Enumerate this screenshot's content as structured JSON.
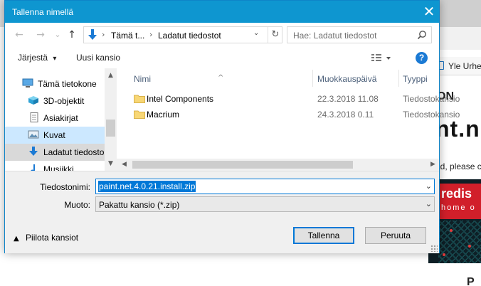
{
  "background": {
    "bookmark_label": "Yle Urheil",
    "heading_fragment": "ON",
    "big_text": "nt.n",
    "small_text": "ad, please c",
    "ad_brand": "redis",
    "ad_tagline": "home o",
    "bottom_letter": "P"
  },
  "dialog": {
    "title": "Tallenna nimellä",
    "close_glyph": "✕"
  },
  "nav": {
    "back_glyph": "←",
    "forward_glyph": "→",
    "recent_glyph": "⌄",
    "up_glyph": "↑",
    "address": {
      "crumbs": [
        "Tämä t...",
        "Ladatut tiedostot"
      ],
      "separator": "›",
      "dropdown_glyph": "⌄",
      "refresh_glyph": "↻"
    },
    "search_placeholder": "Hae: Ladatut tiedostot"
  },
  "toolbar": {
    "organize_label": "Järjestä",
    "organize_caret": "▾",
    "new_folder_label": "Uusi kansio",
    "view_caret": "▾",
    "help_label": "?"
  },
  "tree": [
    {
      "label": "Tämä tietokone",
      "icon": "monitor-icon"
    },
    {
      "label": "3D-objektit",
      "icon": "cube-icon"
    },
    {
      "label": "Asiakirjat",
      "icon": "document-icon"
    },
    {
      "label": "Kuvat",
      "icon": "pictures-icon"
    },
    {
      "label": "Ladatut tiedosto",
      "icon": "download-icon"
    },
    {
      "label": "Musiikki",
      "icon": "music-icon"
    }
  ],
  "columns": {
    "name": "Nimi",
    "modified": "Muokkauspäivä",
    "type": "Tyyppi",
    "sort_glyph": "^"
  },
  "files": [
    {
      "name": "Intel Components",
      "modified": "22.3.2018 11.08",
      "type": "Tiedostokansio"
    },
    {
      "name": "Macrium",
      "modified": "24.3.2018 0.11",
      "type": "Tiedostokansio"
    }
  ],
  "scroll_glyphs": {
    "up": "▲",
    "down": "▼",
    "left": "◀",
    "right": "▶"
  },
  "form": {
    "filename_label": "Tiedostonimi:",
    "filename_value": "paint.net.4.0.21.install.zip",
    "type_label": "Muoto:",
    "type_value": "Pakattu kansio (*.zip)",
    "dropdown_glyph": "⌄",
    "hide_folders_caret": "▲",
    "hide_folders_label": "Piilota kansiot",
    "save_label": "Tallenna",
    "cancel_label": "Peruuta"
  },
  "colors": {
    "titlebar": "#0e96d0",
    "selection": "#0078d7",
    "folder": "#f8d775"
  }
}
